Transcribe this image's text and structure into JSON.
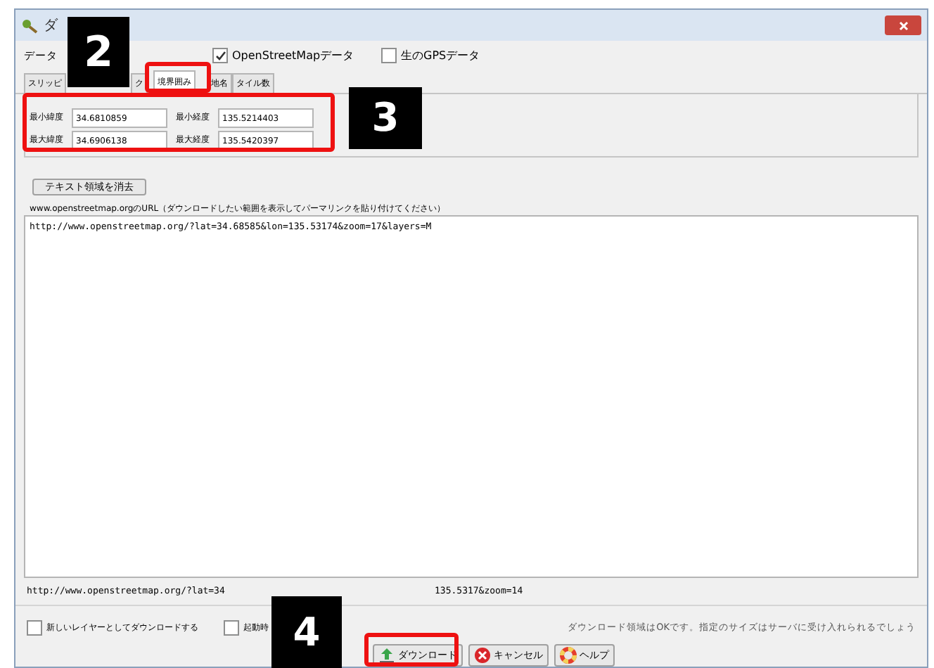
{
  "window": {
    "title": "ダ"
  },
  "data_label": "データ",
  "sources": [
    {
      "label": "OpenStreetMapデータ",
      "checked": true
    },
    {
      "label": "生のGPSデータ",
      "checked": false
    }
  ],
  "tabs": [
    {
      "label": "スリッピ",
      "selected": false
    },
    {
      "label": "ク",
      "selected": false
    },
    {
      "label": "境界囲み",
      "selected": true
    },
    {
      "label": "地名",
      "selected": false
    },
    {
      "label": "タイル数",
      "selected": false
    }
  ],
  "bounds": [
    {
      "label": "最小緯度",
      "value": "34.6810859"
    },
    {
      "label": "最小経度",
      "value": "135.5214403"
    },
    {
      "label": "最大緯度",
      "value": "34.6906138"
    },
    {
      "label": "最大経度",
      "value": "135.5420397"
    }
  ],
  "clear_button": "テキスト領域を消去",
  "url_label": "www.openstreetmap.orgのURL（ダウンロードしたい範囲を表示してパーマリンクを貼り付けてください）",
  "url_value": "http://www.openstreetmap.org/?lat=34.68585&lon=135.53174&zoom=17&layers=M",
  "current_url": [
    "http://www.openstreetmap.org/?lat=34",
    "135.5317&zoom=14"
  ],
  "options": [
    {
      "label": "新しいレイヤーとしてダウンロードする",
      "checked": false
    },
    {
      "label": "起動時",
      "checked": false
    }
  ],
  "status": "ダウンロード領域はOKです。指定のサイズはサーバに受け入れられるでしょう",
  "buttons": [
    {
      "label": "ダウンロード",
      "kind": "download"
    },
    {
      "label": "キャンセル",
      "kind": "cancel"
    },
    {
      "label": "ヘルプ",
      "kind": "help"
    }
  ],
  "callouts": [
    "2",
    "3",
    "4"
  ]
}
